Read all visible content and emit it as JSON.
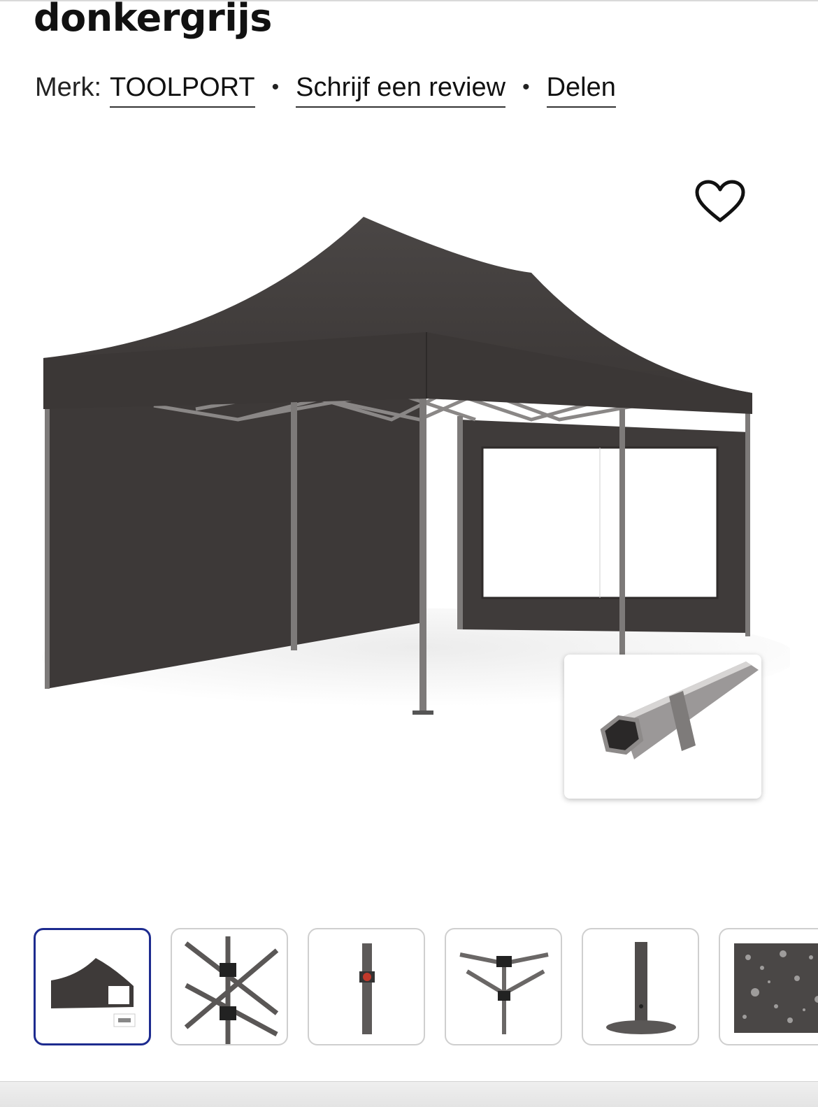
{
  "product": {
    "title": "donkergrijs",
    "brand_label": "Merk:",
    "brand_name": "TOOLPORT",
    "review_link": "Schrijf een review",
    "share_link": "Delen"
  },
  "favorite_icon": "heart-icon",
  "main_image": {
    "subject": "dark grey pop-up tent with side walls and window",
    "tent_color": "#3e3a39",
    "inset_detail": "hexagonal aluminium pole"
  },
  "thumbnails": [
    {
      "subject": "tent overview",
      "selected": true
    },
    {
      "subject": "roof truss joints",
      "selected": false
    },
    {
      "subject": "leg with red push button",
      "selected": false
    },
    {
      "subject": "corner bracket",
      "selected": false
    },
    {
      "subject": "foot plate",
      "selected": false
    },
    {
      "subject": "water beads on fabric",
      "selected": false
    }
  ],
  "colors": {
    "selected_thumb_border": "#1d2b8f",
    "text": "#111111"
  }
}
